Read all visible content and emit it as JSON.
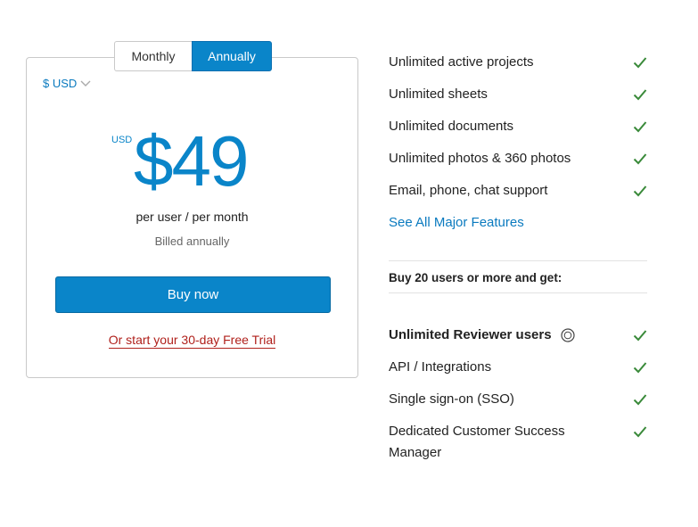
{
  "toggle": {
    "monthly": "Monthly",
    "annually": "Annually",
    "selected": "Annually"
  },
  "currency": {
    "label": "$ USD"
  },
  "price": {
    "currency_small": "USD",
    "amount": "$49",
    "per": "per user / per month",
    "billed": "Billed annually"
  },
  "buy_label": "Buy now",
  "trial_label": "Or start your 30-day Free Trial",
  "features": [
    "Unlimited active projects",
    "Unlimited sheets",
    "Unlimited documents",
    "Unlimited photos & 360 photos",
    "Email, phone, chat support"
  ],
  "see_all": "See All Major Features",
  "buy20": "Buy 20 users or more and get:",
  "extras": {
    "reviewer": "Unlimited Reviewer users",
    "api": "API / Integrations",
    "sso": "Single sign-on (SSO)",
    "csm": "Dedicated Customer Success Manager"
  },
  "colors": {
    "accent": "#0a85c9",
    "check": "#3a8a3a",
    "trial": "#b0201b"
  }
}
